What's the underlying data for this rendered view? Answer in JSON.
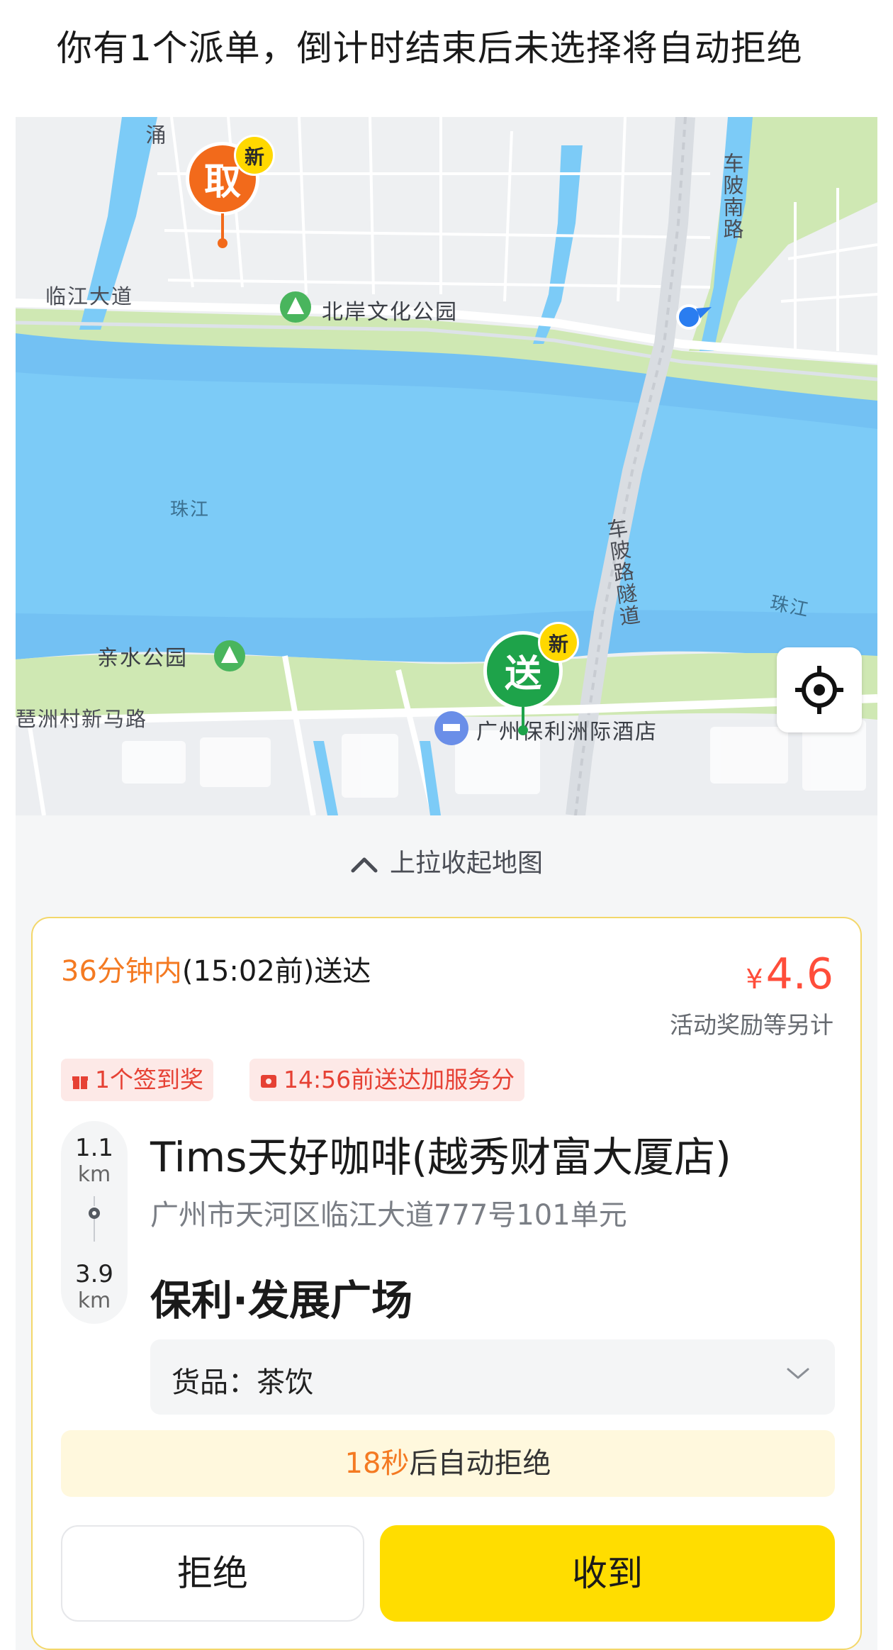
{
  "notice": {
    "text": "你有1个派单，倒计时结束后未选择将自动拒绝"
  },
  "map": {
    "labels": {
      "chong": "涌",
      "linjiang_road": "临江大道",
      "north_park": "北岸文化公园",
      "chepo_south": "车陂南路",
      "zhujiang_1": "珠江",
      "zhujiang_2": "珠江",
      "tunnel": "车陂路隧道",
      "qinshui_park": "亲水公园",
      "pazhou_road": "琶洲村新马路",
      "hotel": "广州保利洲际酒店"
    },
    "pickup_pin": {
      "label": "取",
      "badge": "新",
      "color": "#f26a1b"
    },
    "dropoff_pin": {
      "label": "送",
      "badge": "新",
      "color": "#1ea34a"
    },
    "locate_icon": "locate-crosshair-icon"
  },
  "pull_bar": {
    "label": "上拉收起地图"
  },
  "order": {
    "deliver_highlight": "36分钟内",
    "deliver_rest": "(15:02前)送达",
    "price_symbol": "¥",
    "price_value": "4.6",
    "price_note": "活动奖励等另计",
    "tags": [
      {
        "icon": "gift-icon",
        "text": "1个签到奖"
      },
      {
        "icon": "ticket-icon",
        "text": "14:56前送达加服务分"
      }
    ],
    "distance_pickup": {
      "value": "1.1",
      "unit": "km"
    },
    "distance_dropoff": {
      "value": "3.9",
      "unit": "km"
    },
    "shop_name": "Tims天好咖啡(越秀财富大厦店)",
    "shop_address": "广州市天河区临江大道777号101单元",
    "destination": "保利·发展广场",
    "goods_label": "货品：茶饮",
    "timer_highlight": "18秒",
    "timer_rest": "后自动拒绝",
    "reject_label": "拒绝",
    "accept_label": "收到"
  },
  "colors": {
    "accent_orange": "#f47a22",
    "price_red": "#ff4d3a",
    "accept_yellow": "#ffdd00",
    "water": "#6fc0f2",
    "park_green": "#cfe8b3"
  }
}
